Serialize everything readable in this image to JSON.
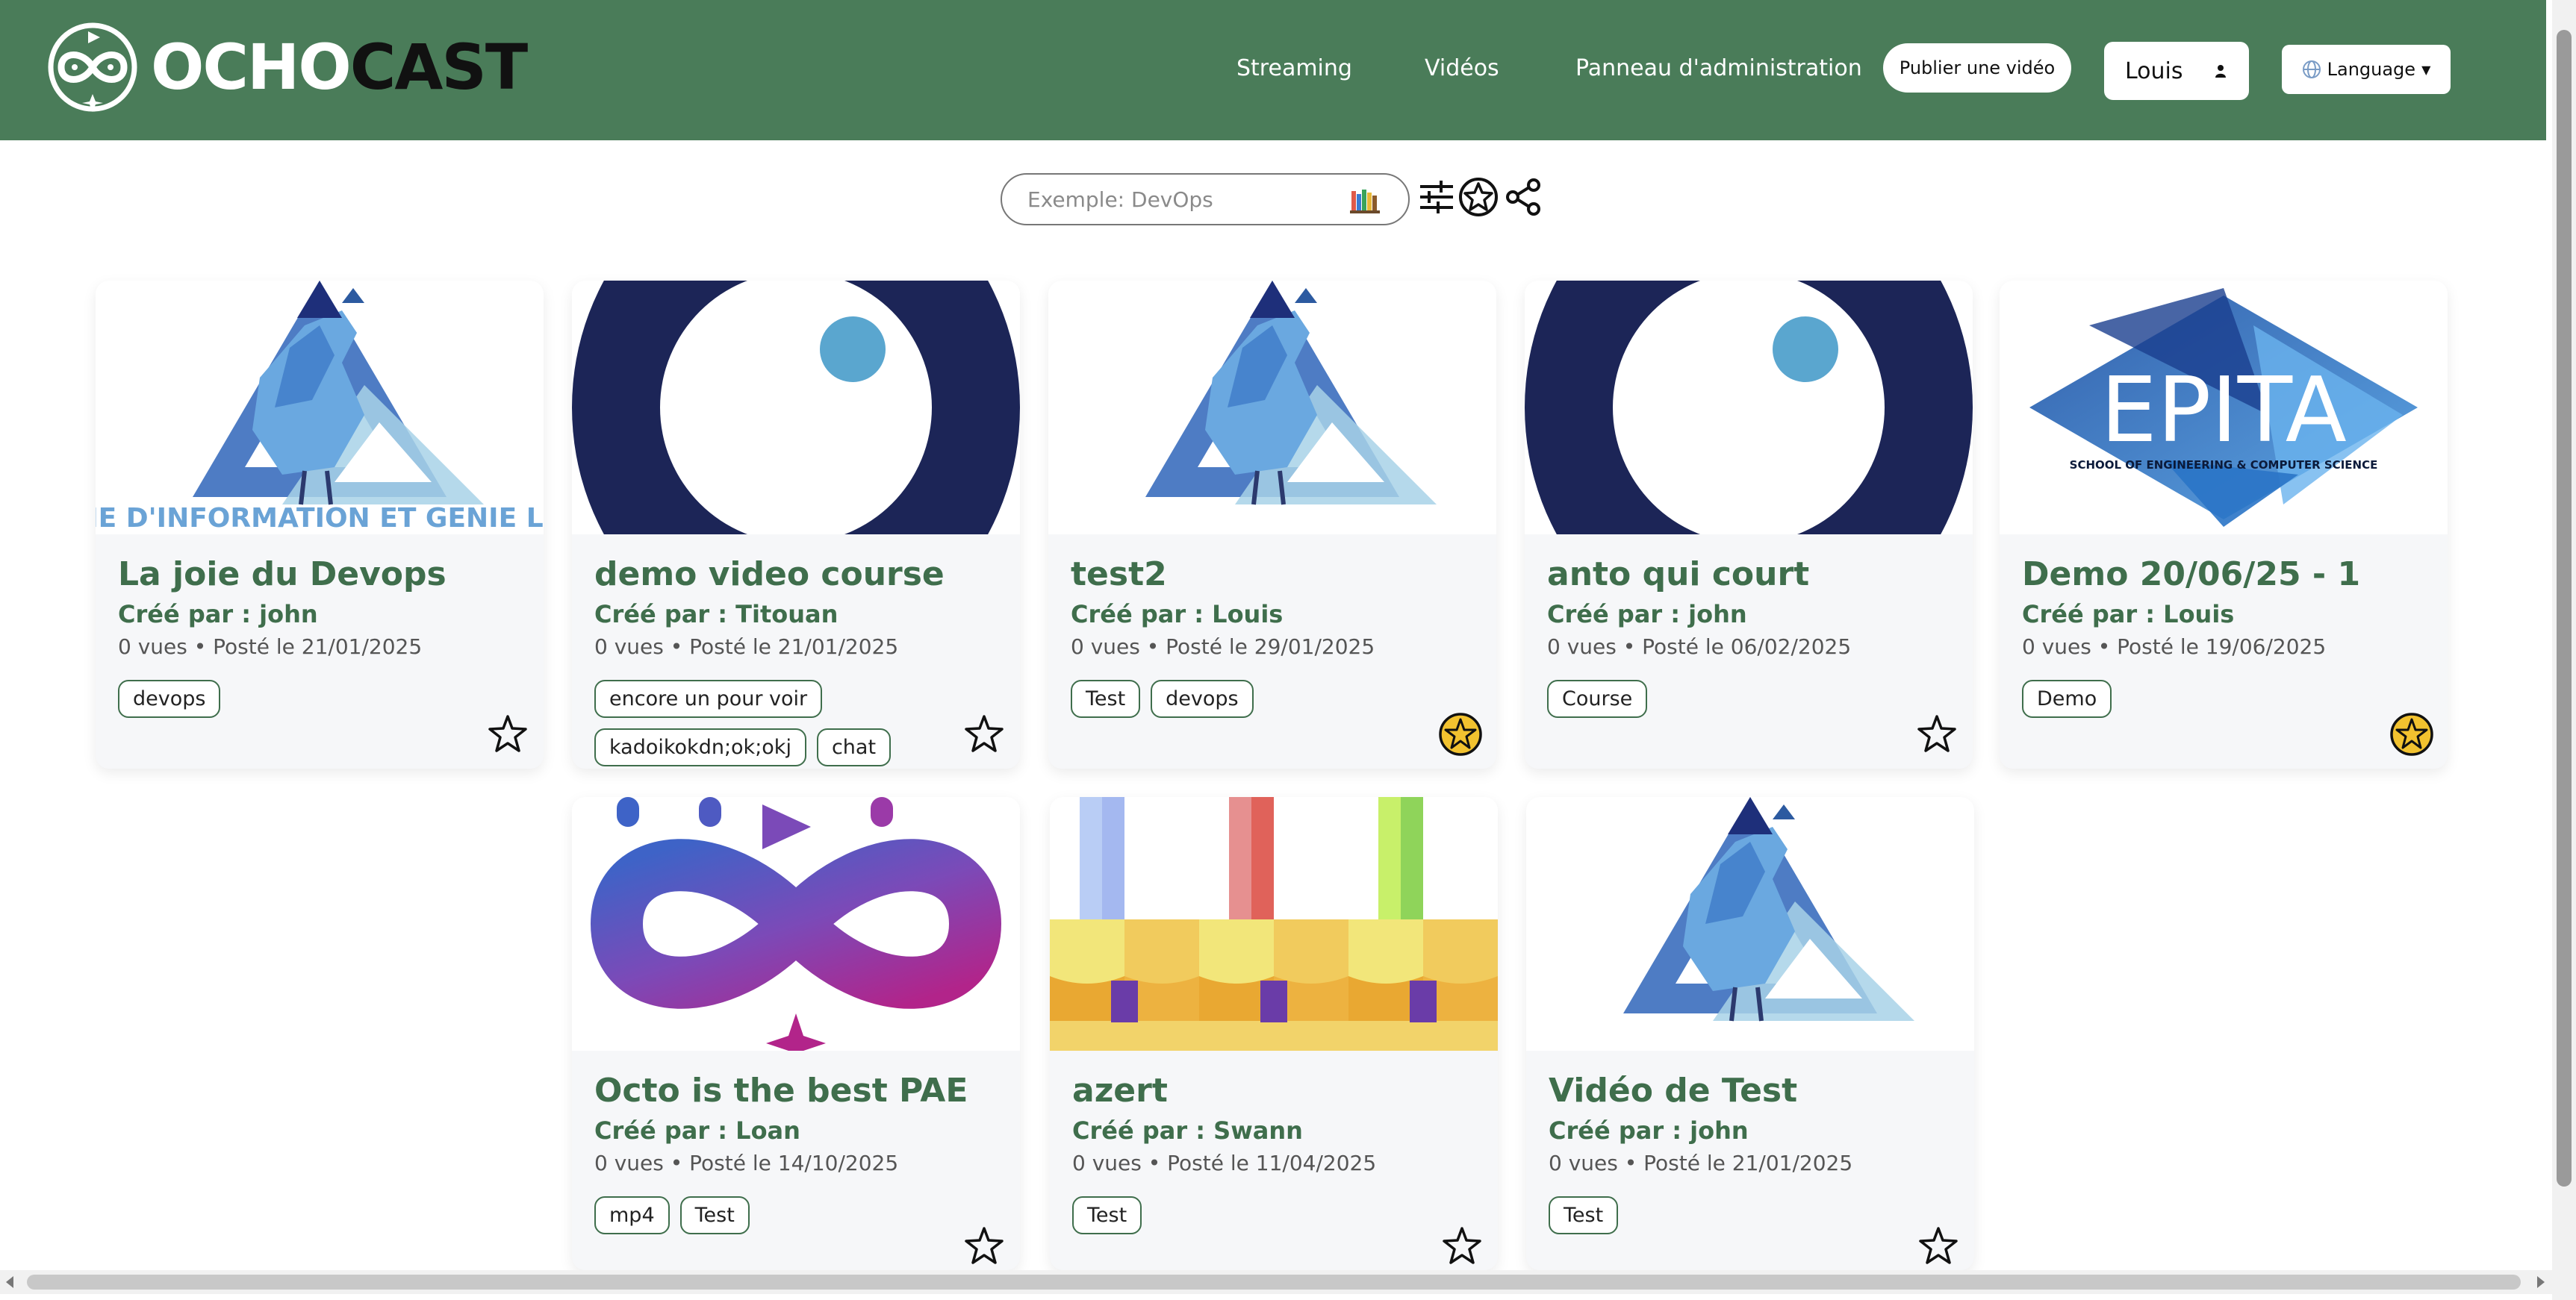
{
  "header": {
    "logo": {
      "part1": "OCHO",
      "part2": "CAST"
    },
    "nav": [
      "Streaming",
      "Vidéos",
      "Panneau d'administration"
    ],
    "publish_label": "Publier une vidéo",
    "user_label": "Louis",
    "language_label": "Language"
  },
  "search": {
    "placeholder": "Exemple: DevOps"
  },
  "videos": [
    {
      "title": "La joie du Devops",
      "author": "Créé par : john",
      "meta": "0 vues • Posté le 21/01/2025",
      "tags": [
        "devops"
      ],
      "favorite": false,
      "thumbnail": "rooster-logo"
    },
    {
      "title": "demo video course",
      "author": "Créé par : Titouan",
      "meta": "0 vues • Posté le 21/01/2025",
      "tags": [
        "encore un pour voir",
        "kadoikokdn;ok;okj",
        "chat"
      ],
      "favorite": false,
      "thumbnail": "eye-circle"
    },
    {
      "title": "test2",
      "author": "Créé par : Louis",
      "meta": "0 vues • Posté le 29/01/2025",
      "tags": [
        "Test",
        "devops"
      ],
      "favorite": true,
      "thumbnail": "rooster-logo"
    },
    {
      "title": "anto qui court",
      "author": "Créé par : john",
      "meta": "0 vues • Posté le 06/02/2025",
      "tags": [
        "Course"
      ],
      "favorite": false,
      "thumbnail": "eye-circle"
    },
    {
      "title": "Demo 20/06/25 - 1",
      "author": "Créé par : Louis",
      "meta": "0 vues • Posté le 19/06/2025",
      "tags": [
        "Demo"
      ],
      "favorite": true,
      "thumbnail": "epita-logo"
    },
    {
      "title": "Octo is the best PAE",
      "author": "Créé par : Loan",
      "meta": "0 vues • Posté le 14/10/2025",
      "tags": [
        "mp4",
        "Test"
      ],
      "favorite": false,
      "thumbnail": "infinity-logo"
    },
    {
      "title": "azert",
      "author": "Créé par : Swann",
      "meta": "0 vues • Posté le 11/04/2025",
      "tags": [
        "Test"
      ],
      "favorite": false,
      "thumbnail": "color-bars"
    },
    {
      "title": "Vidéo de Test",
      "author": "Créé par : john",
      "meta": "0 vues • Posté le 21/01/2025",
      "tags": [
        "Test"
      ],
      "favorite": false,
      "thumbnail": "rooster-logo"
    }
  ],
  "thumb_text": {
    "rooster_ring": "SYSTEME D'INFORMATION ET GENIE LOGICIEL",
    "epita_title": "EPITA",
    "epita_subtitle": "SCHOOL OF ENGINEERING & COMPUTER SCIENCE"
  },
  "colors": {
    "header_bg": "#4a7c59",
    "title_green": "#3f6e4c",
    "favorite_gold": "#f2c22f"
  }
}
